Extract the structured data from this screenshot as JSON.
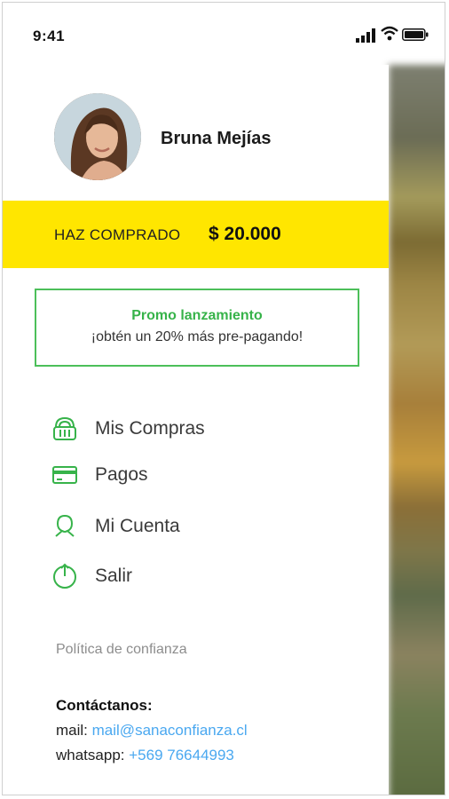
{
  "status_bar": {
    "time": "9:41",
    "icons": [
      "signal-icon",
      "wifi-icon",
      "battery-icon"
    ]
  },
  "profile": {
    "name": "Bruna Mejías"
  },
  "purchased": {
    "label": "HAZ COMPRADO",
    "amount": "$ 20.000"
  },
  "promo": {
    "title": "Promo lanzamiento",
    "text": "¡obtén un 20% más pre-pagando!"
  },
  "menu": {
    "items": [
      {
        "label": "Mis Compras",
        "icon": "basket-icon"
      },
      {
        "label": "Pagos",
        "icon": "credit-card-icon"
      },
      {
        "label": "Mi Cuenta",
        "icon": "user-icon"
      },
      {
        "label": "Salir",
        "icon": "power-icon"
      }
    ]
  },
  "policy": {
    "label": "Política de confianza"
  },
  "contact": {
    "title": "Contáctanos:",
    "mail_label": "mail:",
    "mail_value": "mail@sanaconfianza.cl",
    "whatsapp_label": "whatsapp:",
    "whatsapp_value": "+569 76644993"
  },
  "colors": {
    "accent_yellow": "#ffe600",
    "accent_green": "#37b34a",
    "link_blue": "#4aa8f0"
  }
}
